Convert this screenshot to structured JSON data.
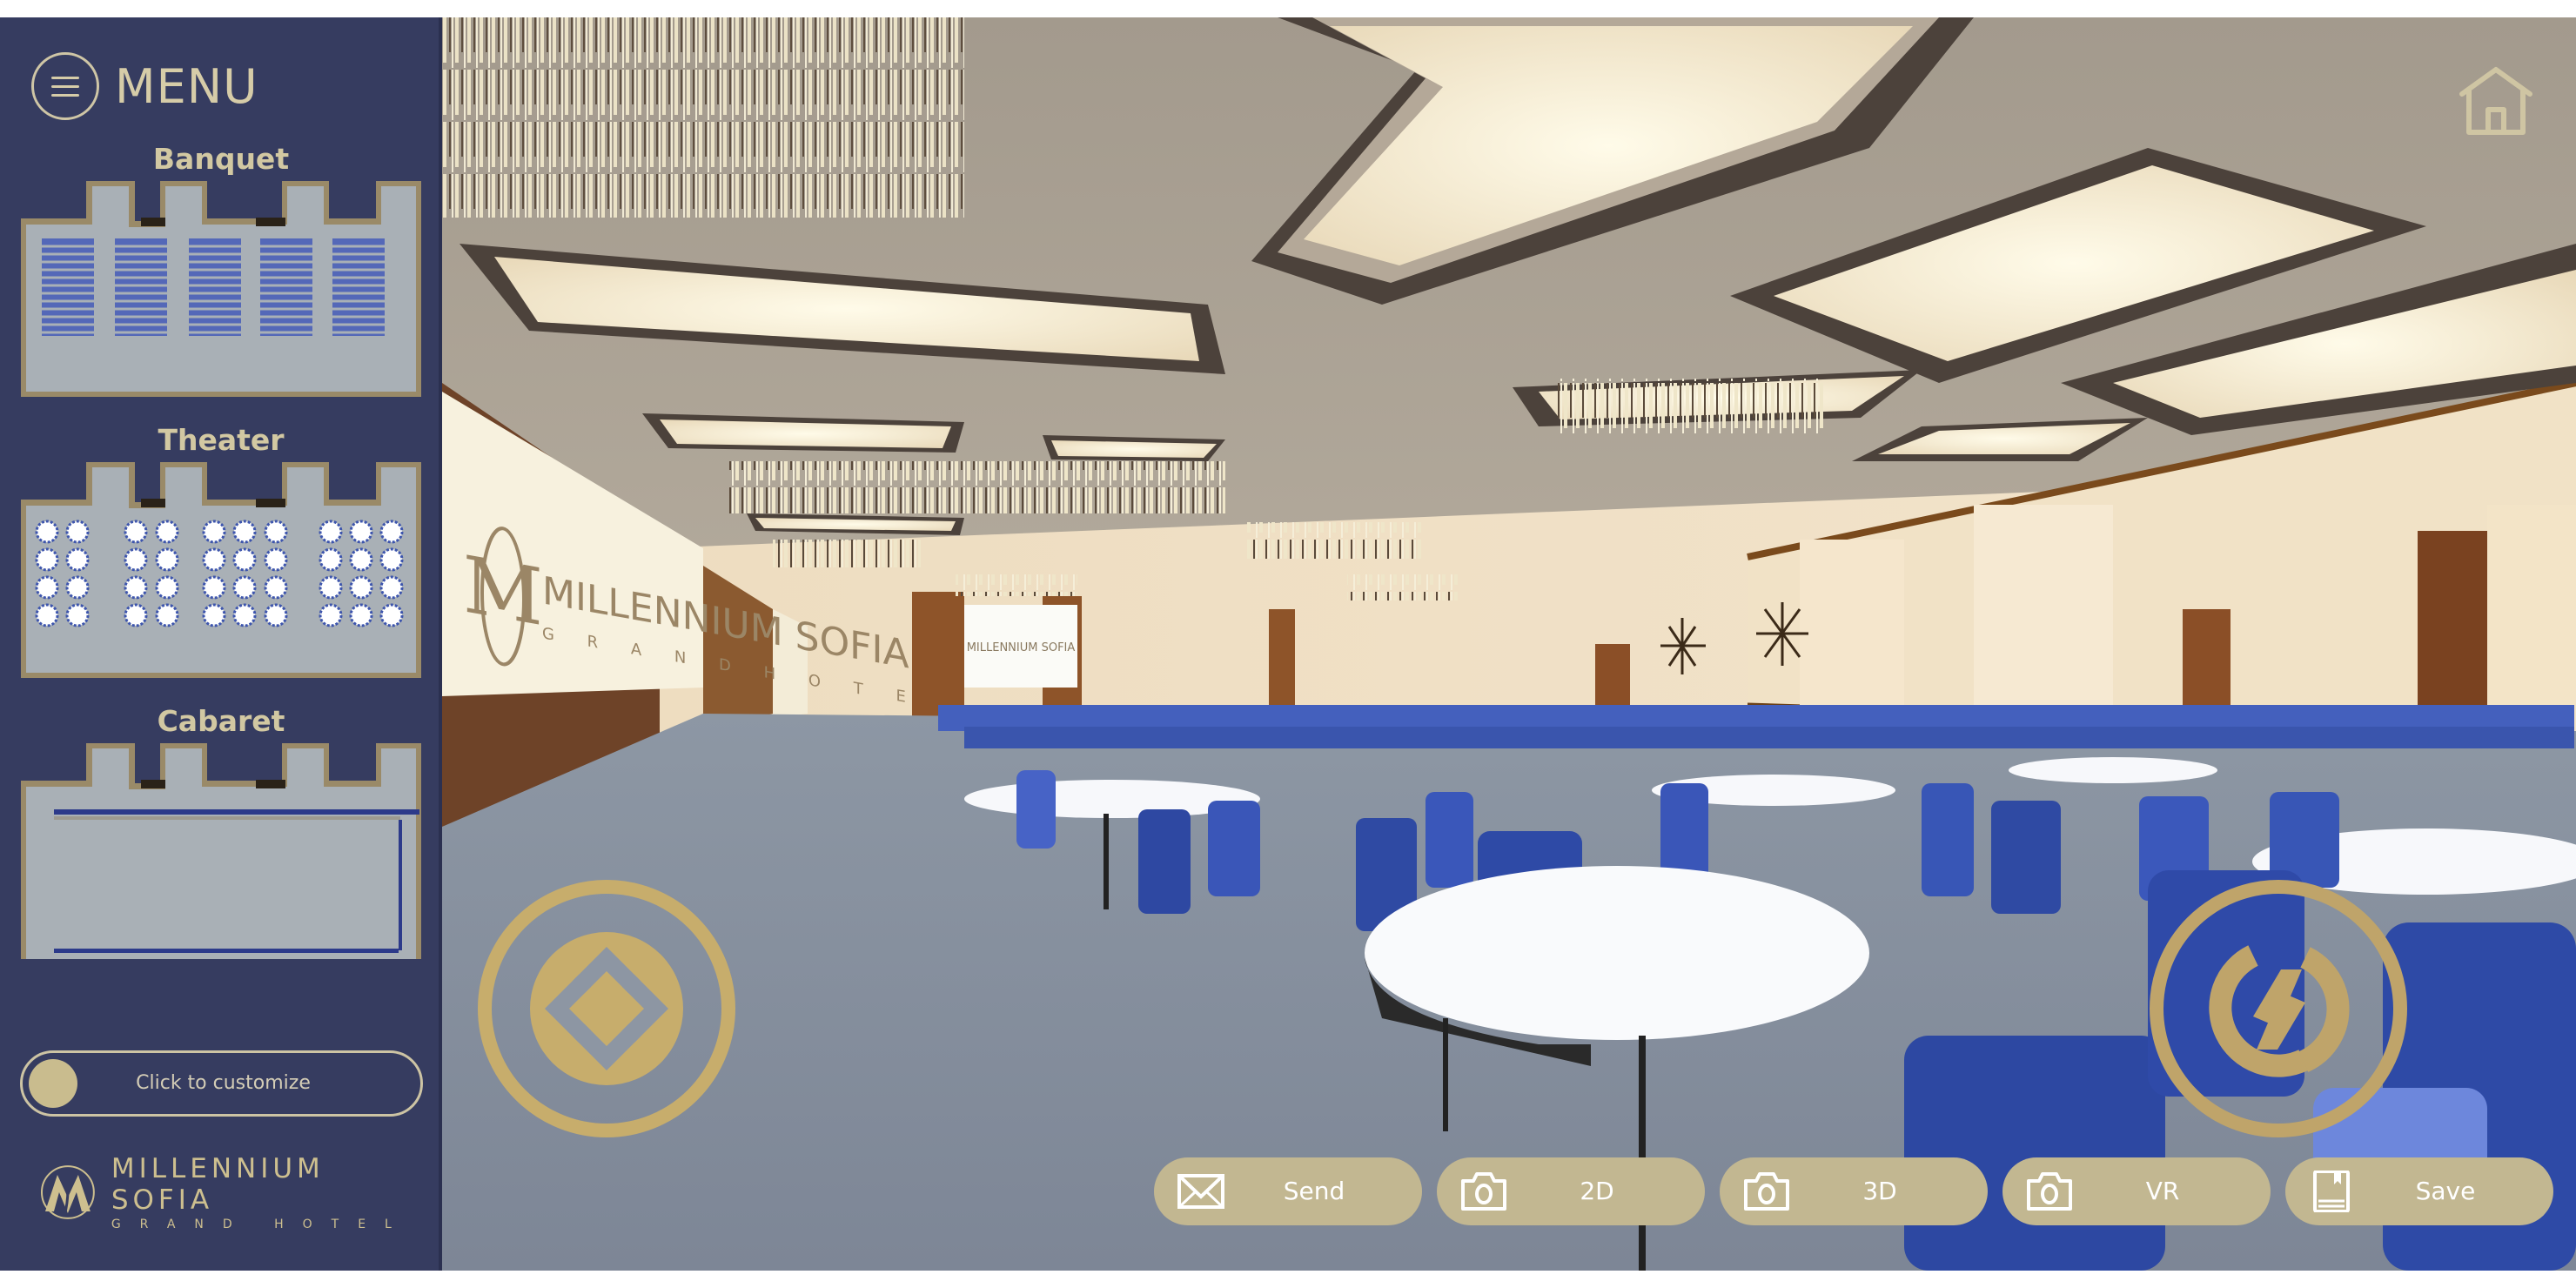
{
  "sidebar": {
    "menu_label": "MENU",
    "layouts": [
      {
        "label": "Banquet"
      },
      {
        "label": "Theater"
      },
      {
        "label": "Cabaret"
      }
    ],
    "customize_label": "Click to customize",
    "brand": {
      "name": "MILLENNIUM SOFIA",
      "subtitle": "GRAND HOTEL"
    }
  },
  "scene": {
    "banner_left": {
      "name": "MILLENNIUM SOFIA",
      "subtitle": "G R A N D   H O T E L"
    },
    "banner_far": {
      "name": "MILLENNIUM SOFIA"
    }
  },
  "toolbar": {
    "buttons": [
      {
        "label": "Send",
        "icon": "envelope-icon"
      },
      {
        "label": "2D",
        "icon": "camera-icon"
      },
      {
        "label": "3D",
        "icon": "camera-icon"
      },
      {
        "label": "VR",
        "icon": "camera-icon"
      },
      {
        "label": "Save",
        "icon": "book-save-icon"
      }
    ]
  },
  "controls": {
    "home": "home-icon",
    "move": "move-joystick-icon",
    "rotate": "rotate-icon"
  },
  "colors": {
    "sidebar_bg": "#363c60",
    "accent_gold": "#c2b791",
    "text_cream": "#d6cca8",
    "chair_blue": "#3b55b0"
  }
}
